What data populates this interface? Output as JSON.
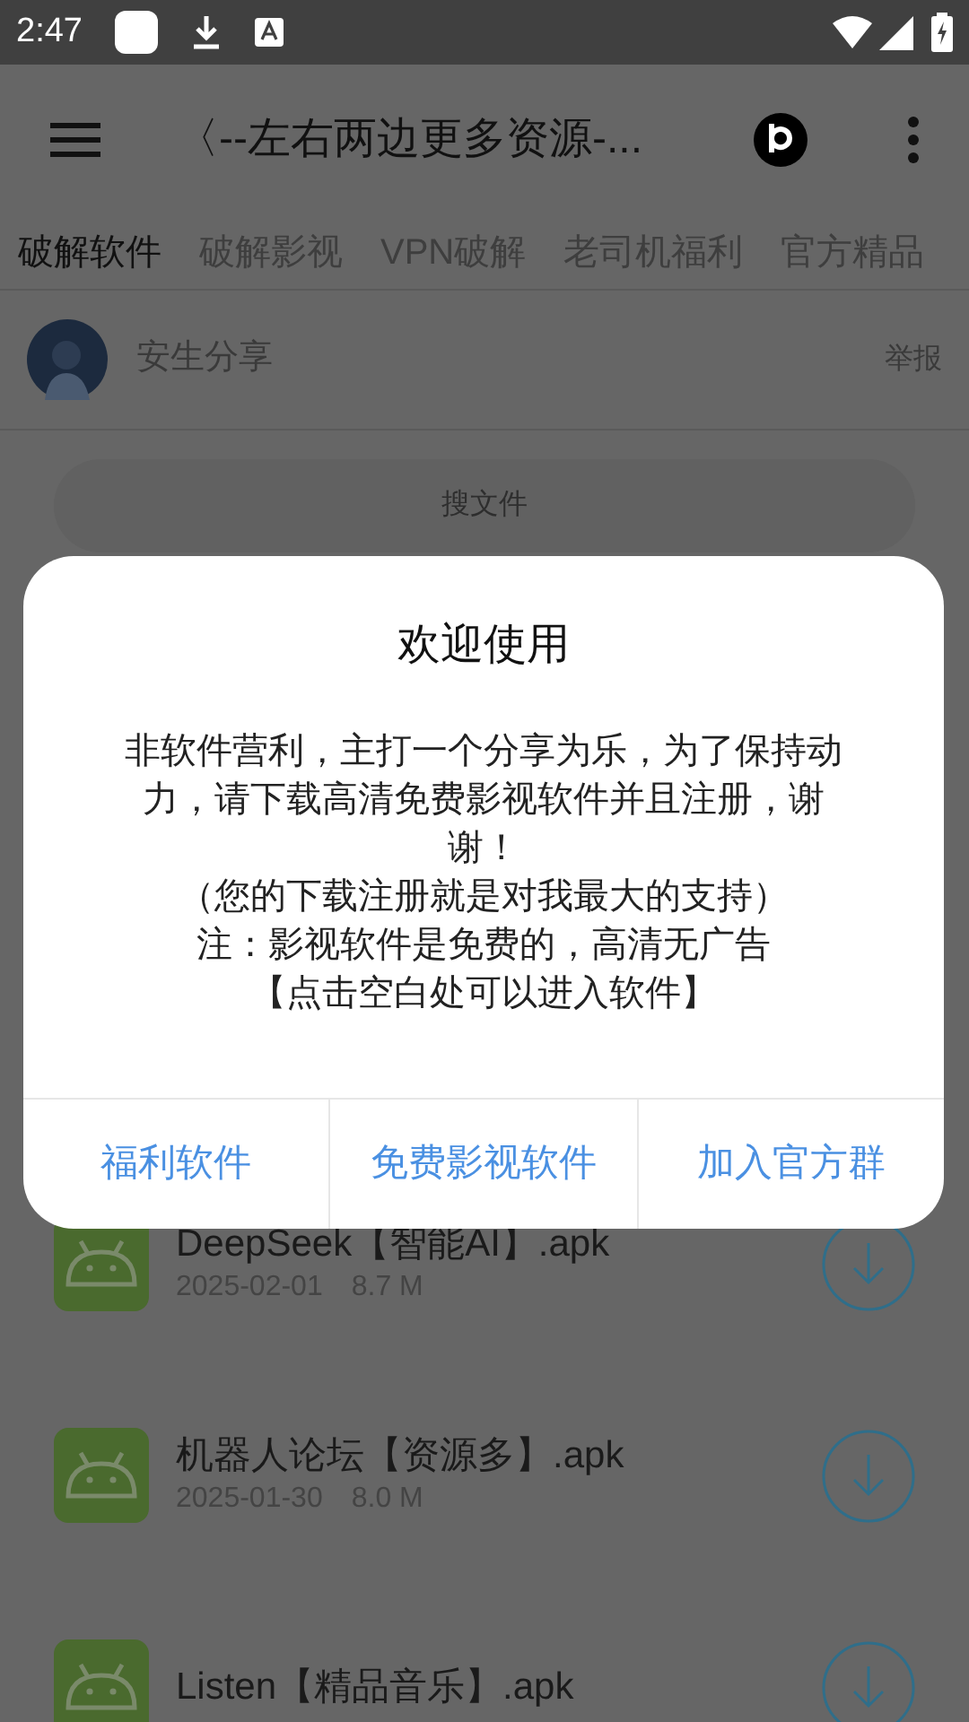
{
  "status_bar": {
    "time": "2:47"
  },
  "app_bar": {
    "title": "〈--左右两边更多资源-..."
  },
  "tabs": [
    {
      "label": "破解软件",
      "selected": true
    },
    {
      "label": "破解影视",
      "selected": false
    },
    {
      "label": "VPN破解",
      "selected": false
    },
    {
      "label": "老司机福利",
      "selected": false
    },
    {
      "label": "官方精品",
      "selected": false
    }
  ],
  "user": {
    "name": "安生分享",
    "report": "举报"
  },
  "search": {
    "placeholder": "搜文件"
  },
  "files": [
    {
      "name": "DeepSeek【智能AI】.apk",
      "date": "2025-02-01",
      "size": "8.7 M"
    },
    {
      "name": "机器人论坛【资源多】.apk",
      "date": "2025-01-30",
      "size": "8.0 M"
    },
    {
      "name": "Listen【精品音乐】.apk"
    }
  ],
  "dialog": {
    "title": "欢迎使用",
    "lines": [
      "非软件营利，主打一个分享为乐，为了保持动力，请下载高清免费影视软件并且注册，谢谢！",
      "（您的下载注册就是对我最大的支持）",
      "注：影视软件是免费的，高清无广告",
      "【点击空白处可以进入软件】"
    ],
    "buttons": [
      "福利软件",
      "免费影视软件",
      "加入官方群"
    ]
  }
}
